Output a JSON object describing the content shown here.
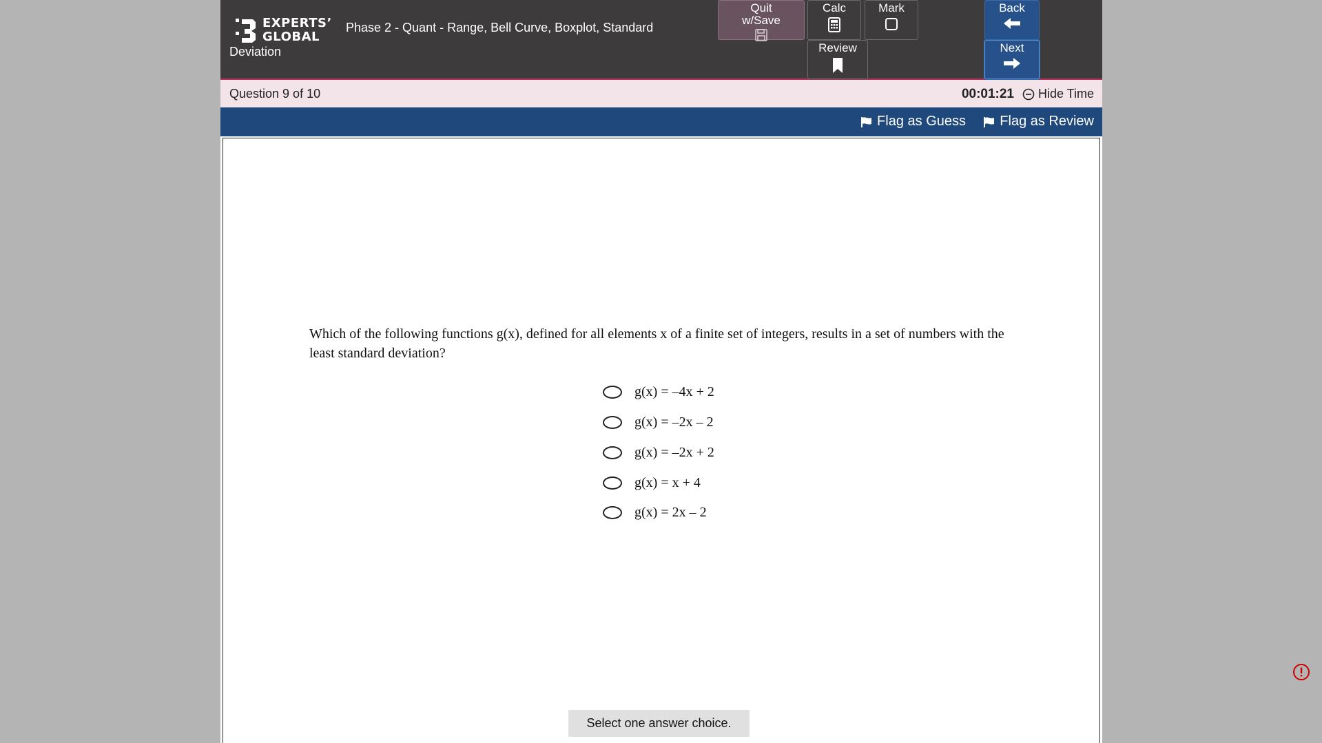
{
  "header": {
    "logo_line1": "EXPERTS’",
    "logo_line2": "GLOBAL",
    "title_line1": "Phase 2 - Quant - Range, Bell Curve, Boxplot, Standard",
    "title_line2": "Deviation",
    "quit_label": "Quit\nw/Save",
    "calc_label": "Calc",
    "mark_label": "Mark",
    "review_label": "Review",
    "back_label": "Back",
    "next_label": "Next"
  },
  "question_bar": {
    "counter": "Question 9 of 10",
    "timer": "00:01:21",
    "hide_time_label": "Hide Time"
  },
  "flag_bar": {
    "guess_label": "Flag as Guess",
    "review_label": "Flag as Review"
  },
  "question": {
    "text": "Which of the following functions g(x), defined for all elements x of a finite set of integers, results in a set of numbers with the least standard deviation?"
  },
  "choices": [
    {
      "label": "g(x) = –4x + 2",
      "selected": false
    },
    {
      "label": "g(x) = –2x – 2",
      "selected": false
    },
    {
      "label": "g(x) = –2x + 2",
      "selected": false
    },
    {
      "label": "g(x) = x + 4",
      "selected": false
    },
    {
      "label": "g(x) = 2x – 2",
      "selected": false
    }
  ],
  "footer": {
    "hint": "Select one answer choice."
  },
  "colors": {
    "header_bg": "#3d3b3c",
    "accent_line": "#b5305a",
    "question_bar_bg": "#f2e4e8",
    "flag_bar_bg": "#1f497d",
    "nav_button_bg": "#27518a",
    "quit_button_bg": "#69535f",
    "report_icon": "#cc0000"
  }
}
